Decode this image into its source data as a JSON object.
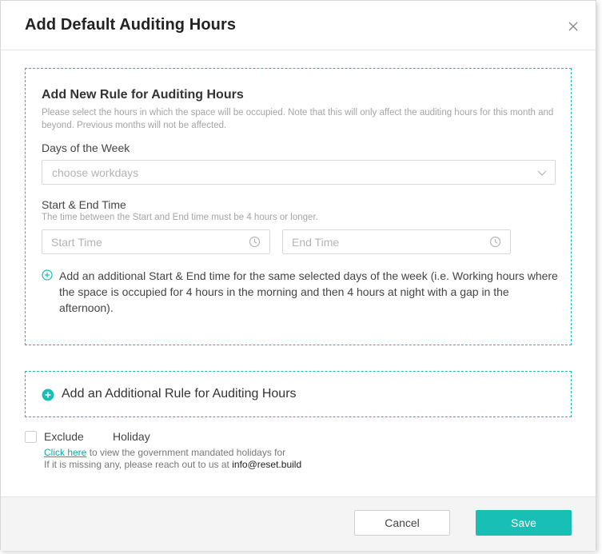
{
  "modal": {
    "title": "Add Default Auditing Hours",
    "close_icon": "close-icon"
  },
  "rule": {
    "title": "Add New Rule for Auditing Hours",
    "description": "Please select the hours in which the space will be occupied. Note that this will only affect the auditing hours for this month and beyond. Previous months will not be affected.",
    "days_label": "Days of the Week",
    "days_placeholder": "choose workdays",
    "time_label": "Start & End Time",
    "time_sublabel": "The time between the Start and End time must be 4 hours or longer.",
    "start_placeholder": "Start Time",
    "end_placeholder": "End Time",
    "add_time_text": "Add an additional Start & End time for the same selected days of the week (i.e. Working hours where the space is occupied for 4 hours in the morning and then 4 hours at night with a gap in the afternoon)."
  },
  "add_rule": {
    "label": "Add an Additional Rule for Auditing Hours"
  },
  "holiday": {
    "exclude_label": "Exclude",
    "holiday_label": "Holiday",
    "exclude_checked": false,
    "link_text": "Click here",
    "line1_rest": " to view the government mandated holidays for",
    "line2": "If it is missing any, please reach out to us at ",
    "email": "info@reset.build"
  },
  "footer": {
    "cancel_label": "Cancel",
    "save_label": "Save"
  },
  "colors": {
    "accent": "#17bfb4",
    "dashed_border": "#22b5ad",
    "link": "#10a8a0"
  }
}
